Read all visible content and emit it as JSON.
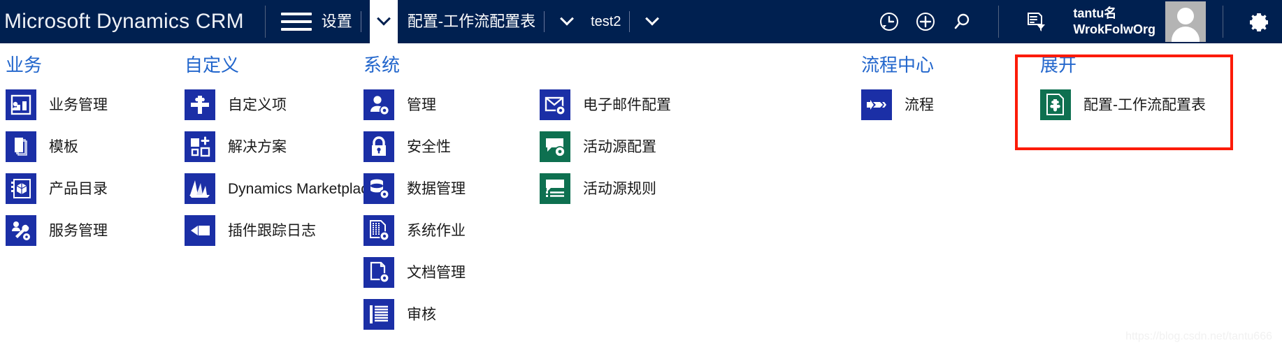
{
  "navbar": {
    "brand": "Microsoft Dynamics CRM",
    "menu_icon": "hamburger-icon",
    "breadcrumbs": [
      {
        "label": "设置",
        "caret": "chevron-down-icon",
        "caret_active": true
      },
      {
        "label": "配置-工作流配置表",
        "caret": "chevron-down-icon",
        "caret_active": false
      },
      {
        "label": "test2",
        "caret": "chevron-down-icon",
        "caret_active": false
      }
    ],
    "actions": [
      {
        "name": "recent-items-icon",
        "title": "最近使用的记录"
      },
      {
        "name": "quick-create-icon",
        "title": "快速创建"
      },
      {
        "name": "search-icon",
        "title": "搜索"
      },
      {
        "name": "advanced-find-icon",
        "title": "高级查找"
      }
    ],
    "user": {
      "name": "tantu名",
      "org": "WrokFolwOrg",
      "avatar": "user-avatar"
    },
    "settings_icon": "gear-icon"
  },
  "colors": {
    "navbar_bg": "#002050",
    "tile_blue": "#1b2fa6",
    "tile_green": "#0e7050",
    "heading_blue": "#2266cc",
    "highlight_border": "#fc1b07"
  },
  "sitemap": {
    "columns": [
      {
        "title": "业务",
        "items": [
          {
            "label": "业务管理",
            "icon": "business-management-icon",
            "color": "blue"
          },
          {
            "label": "模板",
            "icon": "templates-icon",
            "color": "blue"
          },
          {
            "label": "产品目录",
            "icon": "product-catalog-icon",
            "color": "blue"
          },
          {
            "label": "服务管理",
            "icon": "service-management-icon",
            "color": "blue"
          }
        ]
      },
      {
        "title": "自定义",
        "items": [
          {
            "label": "自定义项",
            "icon": "customizations-puzzle-icon",
            "color": "blue"
          },
          {
            "label": "解决方案",
            "icon": "solutions-icon",
            "color": "blue"
          },
          {
            "label": "Dynamics Marketplace",
            "icon": "marketplace-icon",
            "color": "blue"
          },
          {
            "label": "插件跟踪日志",
            "icon": "plugin-trace-log-icon",
            "color": "blue"
          }
        ]
      },
      {
        "title": "系统",
        "items": [
          {
            "label": "管理",
            "icon": "administration-icon",
            "color": "blue"
          },
          {
            "label": "安全性",
            "icon": "security-lock-icon",
            "color": "blue"
          },
          {
            "label": "数据管理",
            "icon": "data-management-icon",
            "color": "blue"
          },
          {
            "label": "系统作业",
            "icon": "system-jobs-icon",
            "color": "blue"
          },
          {
            "label": "文档管理",
            "icon": "document-management-icon",
            "color": "blue"
          },
          {
            "label": "审核",
            "icon": "auditing-icon",
            "color": "blue"
          }
        ]
      },
      {
        "title": "",
        "items": [
          {
            "label": "电子邮件配置",
            "icon": "email-configuration-icon",
            "color": "blue"
          },
          {
            "label": "活动源配置",
            "icon": "activity-feeds-configuration-icon",
            "color": "green"
          },
          {
            "label": "活动源规则",
            "icon": "activity-feeds-rules-icon",
            "color": "green"
          }
        ]
      },
      {
        "title": "流程中心",
        "items": [
          {
            "label": "流程",
            "icon": "processes-icon",
            "color": "blue"
          }
        ]
      },
      {
        "title": "展开",
        "highlighted": true,
        "items": [
          {
            "label": "配置-工作流配置表",
            "icon": "workflow-config-table-icon",
            "color": "green"
          }
        ]
      }
    ]
  },
  "watermark": "https://blog.csdn.net/tantu666"
}
